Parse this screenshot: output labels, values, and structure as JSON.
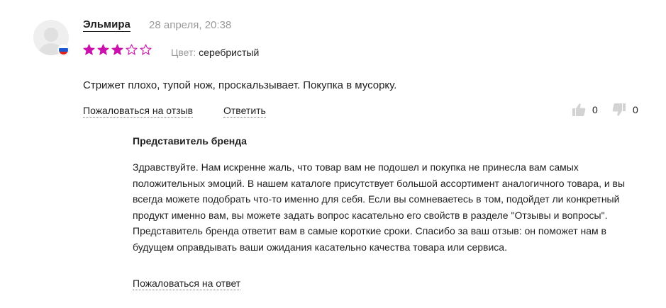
{
  "review": {
    "author": "Эльмира",
    "date": "28 апреля, 20:38",
    "rating": 3,
    "max_rating": 5,
    "star_color": "#cb11ab",
    "color_label": "Цвет:",
    "color_value": "серебристый",
    "text": "Стрижет плохо, тупой нож, проскальзывает. Покупка в мусорку.",
    "complain_label": "Пожаловаться на отзыв",
    "reply_label": "Ответить",
    "likes": "0",
    "dislikes": "0"
  },
  "brand_answer": {
    "title": "Представитель бренда",
    "text": "Здравствуйте. Нам искренне жаль, что товар вам не подошел и покупка не принесла вам самых положительных эмоций. В нашем каталоге присутствует большой ассортимент аналогичного товара, и вы всегда можете подобрать что-то именно для себя. Если вы сомневаетесь в том, подойдет ли конкретный продукт именно вам, вы можете задать вопрос касательно его свойств в разделе \"Отзывы и вопросы\". Представитель бренда ответит вам в самые короткие сроки. Спасибо за ваш отзыв: он поможет нам в будущем оправдывать ваши ожидания касательно качества товара или сервиса.",
    "complain_label": "Пожаловаться на ответ"
  },
  "icons": {
    "avatar": "user-placeholder-icon",
    "flag": "russia-flag-icon",
    "like": "thumbs-up-icon",
    "dislike": "thumbs-down-icon",
    "star": "star-icon"
  }
}
